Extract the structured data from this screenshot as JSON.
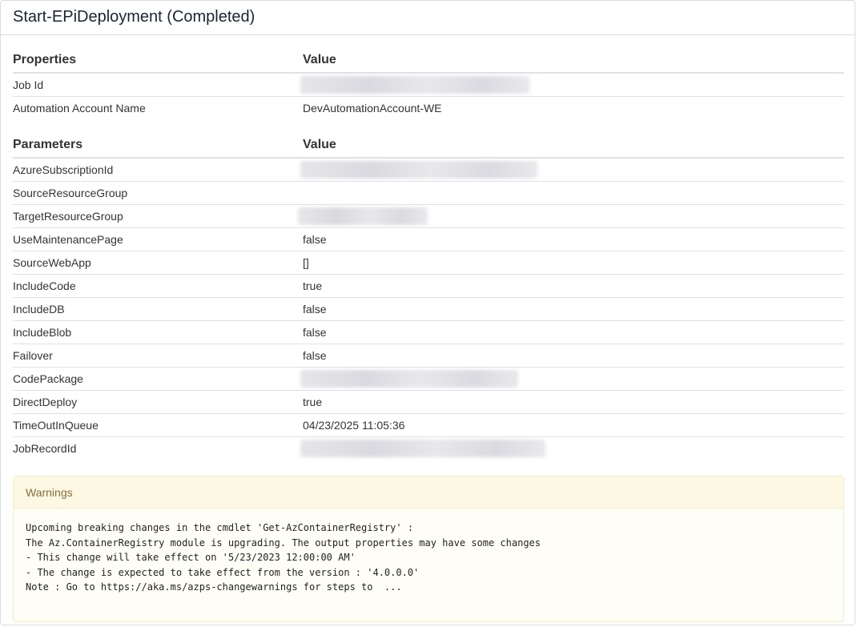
{
  "title": "Start-EPiDeployment (Completed)",
  "properties": {
    "header_key": "Properties",
    "header_value": "Value",
    "rows": [
      {
        "key": "Job Id",
        "value": "",
        "redacted": true
      },
      {
        "key": "Automation Account Name",
        "value": "DevAutomationAccount-WE",
        "redacted": false
      }
    ]
  },
  "parameters": {
    "header_key": "Parameters",
    "header_value": "Value",
    "rows": [
      {
        "key": "AzureSubscriptionId",
        "value": "",
        "redacted": true
      },
      {
        "key": "SourceResourceGroup",
        "value": "",
        "redacted": false
      },
      {
        "key": "TargetResourceGroup",
        "value": "",
        "redacted": true
      },
      {
        "key": "UseMaintenancePage",
        "value": "false",
        "redacted": false
      },
      {
        "key": "SourceWebApp",
        "value": "[]",
        "redacted": false
      },
      {
        "key": "IncludeCode",
        "value": "true",
        "redacted": false
      },
      {
        "key": "IncludeDB",
        "value": "false",
        "redacted": false
      },
      {
        "key": "IncludeBlob",
        "value": "false",
        "redacted": false
      },
      {
        "key": "Failover",
        "value": "false",
        "redacted": false
      },
      {
        "key": "CodePackage",
        "value": "",
        "redacted": true
      },
      {
        "key": "DirectDeploy",
        "value": "true",
        "redacted": false
      },
      {
        "key": "TimeOutInQueue",
        "value": "04/23/2025 11:05:36",
        "redacted": false
      },
      {
        "key": "JobRecordId",
        "value": "",
        "redacted": true
      }
    ]
  },
  "warnings": {
    "title": "Warnings",
    "lines": [
      "Upcoming breaking changes in the cmdlet 'Get-AzContainerRegistry' :",
      "The Az.ContainerRegistry module is upgrading. The output properties may have some changes",
      "- This change will take effect on '5/23/2023 12:00:00 AM'",
      "- The change is expected to take effect from the version : '4.0.0.0'",
      "Note : Go to https://aka.ms/azps-changewarnings for steps to  ..."
    ]
  },
  "colors": {
    "warning_header_bg": "#fcf8e3",
    "warning_title": "#8a6d3b",
    "border": "#d9dce0"
  }
}
